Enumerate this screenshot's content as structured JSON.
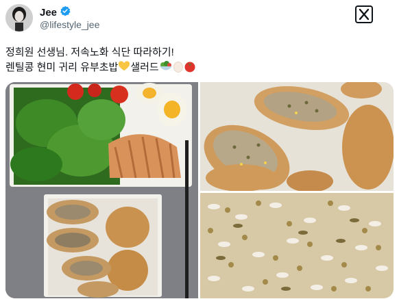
{
  "author": {
    "display_name": "Jee",
    "handle": "@lifestyle_jee",
    "verified": true
  },
  "tweet": {
    "line1": "정희원 선생님. 저속노화 식단 따라하기!",
    "line2": "렌틸콩 현미 귀리 유부초밥"
  },
  "media": {
    "photos": [
      "salad-and-inari-photo",
      "inari-closeup-photo",
      "mixed-grain-rice-photo"
    ]
  },
  "icons": {
    "verified": "verified-badge-icon",
    "logo": "x-logo-icon",
    "emoji": [
      "yellow-heart-icon",
      "salad-icon",
      "egg-icon",
      "tomato-icon"
    ]
  },
  "colors": {
    "verified_blue": "#1d9bf0",
    "handle_gray": "#536471",
    "text": "#0f1419"
  }
}
